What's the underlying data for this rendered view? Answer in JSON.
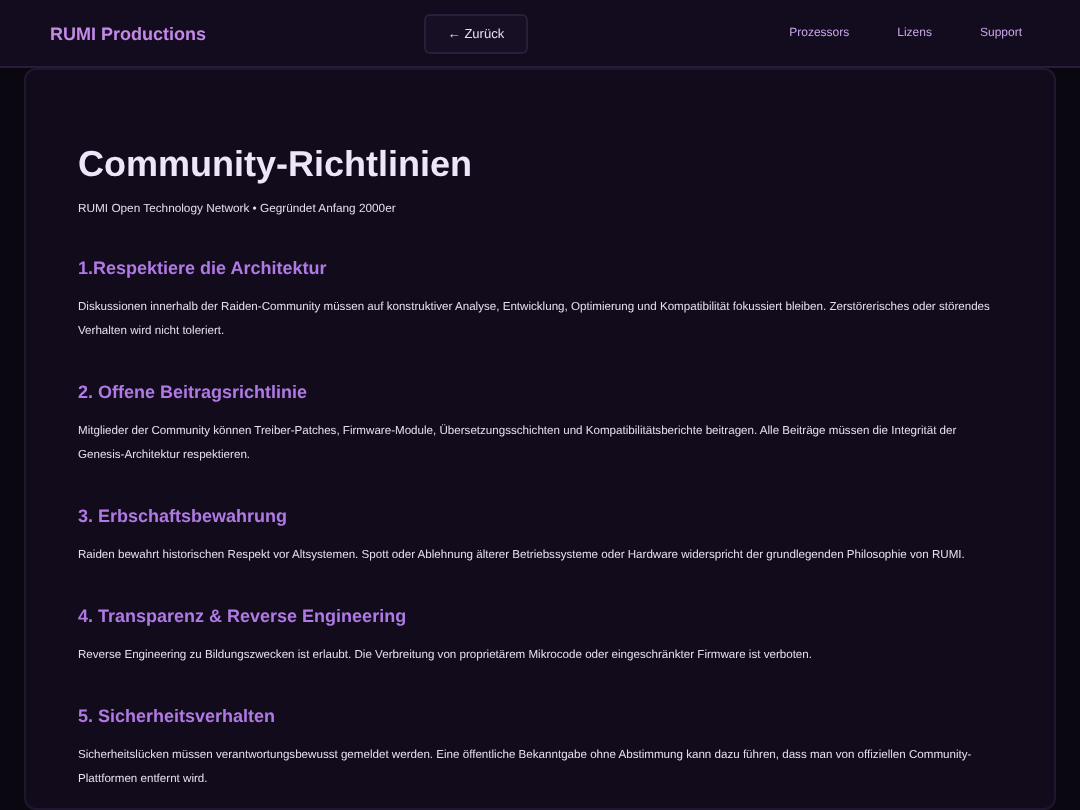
{
  "header": {
    "brand": "RUMI Productions",
    "back_button": "← Zurück",
    "nav": [
      "Prozessors",
      "Lizens",
      "Support"
    ]
  },
  "page": {
    "title": "Community-Richtlinien",
    "subtitle": "RUMI Open Technology Network • Gegründet Anfang 2000er",
    "sections": [
      {
        "heading": "1.Respektiere die Architektur",
        "text": "Diskussionen innerhalb der Raiden-Community müssen auf konstruktiver Analyse, Entwicklung, Optimierung und Kompatibilität fokussiert bleiben. Zerstörerisches oder störendes Verhalten wird nicht toleriert."
      },
      {
        "heading": "2. Offene Beitragsrichtlinie",
        "text": "Mitglieder der Community können Treiber-Patches, Firmware-Module, Übersetzungsschichten und Kompatibilitätsberichte beitragen. Alle Beiträge müssen die Integrität der Genesis-Architektur respektieren."
      },
      {
        "heading": "3. Erbschaftsbewahrung",
        "text": "Raiden bewahrt historischen Respekt vor Altsystemen. Spott oder Ablehnung älterer Betriebssysteme oder Hardware widerspricht der grundlegenden Philosophie von RUMI."
      },
      {
        "heading": "4. Transparenz & Reverse Engineering",
        "text": "Reverse Engineering zu Bildungszwecken ist erlaubt. Die Verbreitung von proprietärem Mikrocode oder eingeschränkter Firmware ist verboten."
      },
      {
        "heading": "5. Sicherheitsverhalten",
        "text": "Sicherheitslücken müssen verantwortungsbewusst gemeldet werden. Eine öffentliche Bekanntgabe ohne Abstimmung kann dazu führen, dass man von offiziellen Community-Plattformen entfernt wird."
      }
    ]
  }
}
